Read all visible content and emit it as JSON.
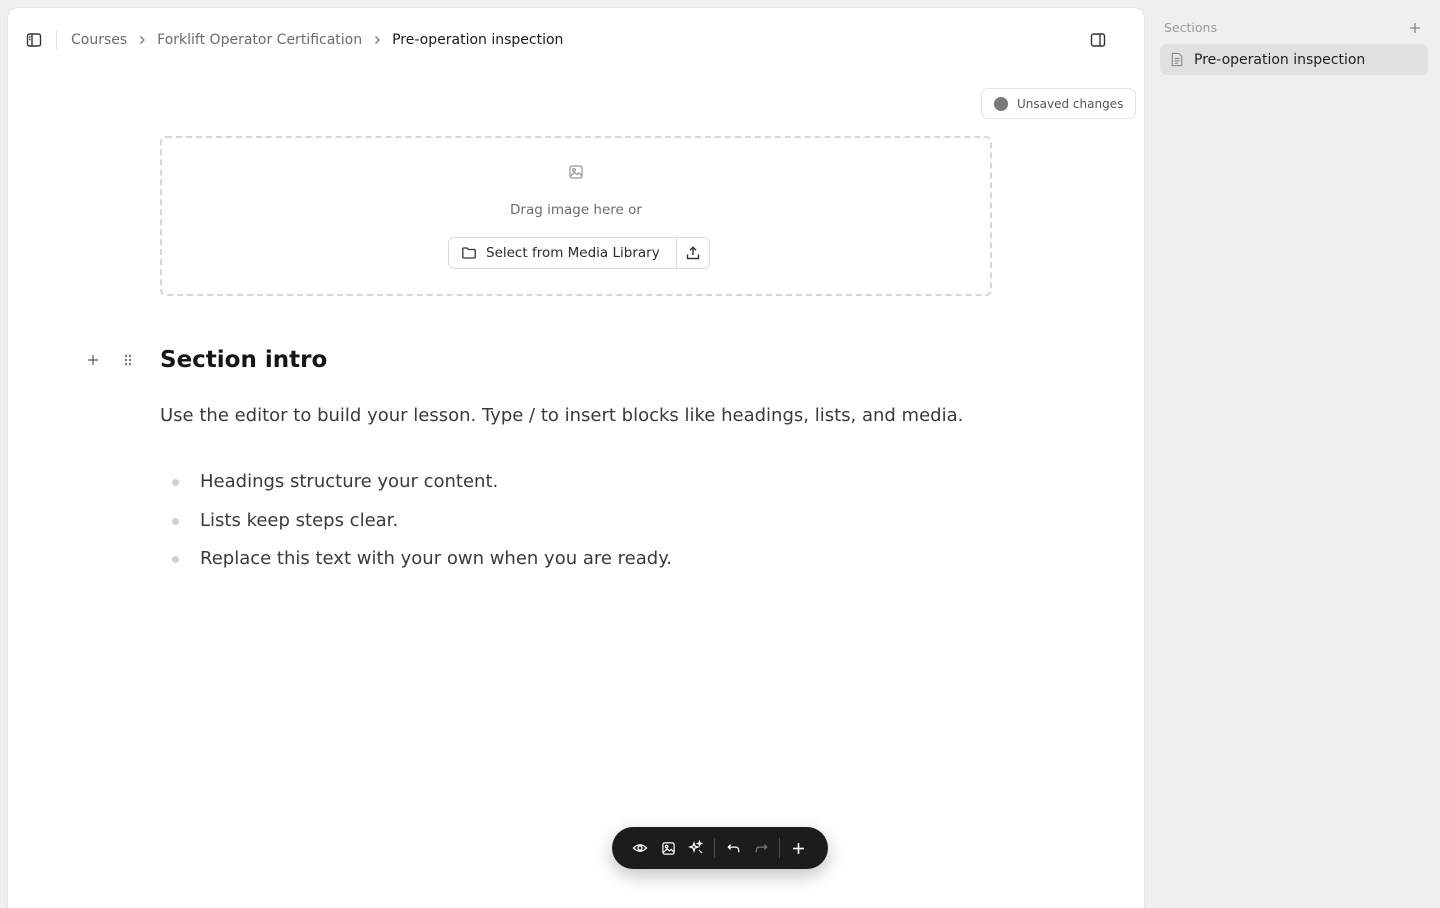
{
  "breadcrumb": {
    "items": [
      "Courses",
      "Forklift Operator Certification",
      "Pre-operation inspection"
    ]
  },
  "status": {
    "unsaved_label": "Unsaved changes"
  },
  "dropzone": {
    "hint": "Drag image here or",
    "media_button": "Select from Media Library"
  },
  "content": {
    "heading": "Section intro",
    "paragraph": "Use the editor to build your lesson. Type / to insert blocks like headings, lists, and media.",
    "bullets": [
      "Headings structure your content.",
      "Lists keep steps clear.",
      "Replace this text with your own when you are ready."
    ]
  },
  "sections_panel": {
    "title": "Sections",
    "items": [
      {
        "label": "Pre-operation inspection"
      }
    ]
  },
  "icons": {
    "sidebar_toggle": "sidebar-icon",
    "panel_toggle": "panel-right-icon",
    "image": "image-icon",
    "folder": "folder-icon",
    "upload": "upload-icon",
    "plus": "plus-icon",
    "drag": "grip-icon",
    "preview": "eye-icon",
    "ai": "sparkles-icon",
    "undo": "undo-icon",
    "redo": "redo-icon",
    "document": "file-text-icon"
  },
  "colors": {
    "toolbar_bg": "#1c1c1c",
    "selected_item_bg": "#e0e0e0",
    "app_bg": "#efefef"
  }
}
